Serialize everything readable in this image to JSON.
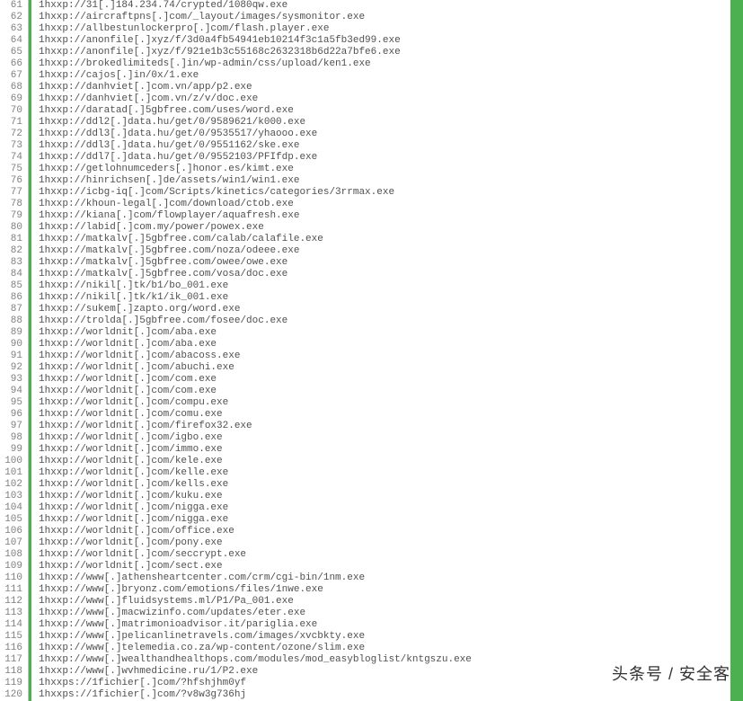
{
  "startLine": 61,
  "lines": [
    "1hxxp://31[.]184.234.74/crypted/1080qw.exe",
    "1hxxp://aircraftpns[.]com/_layout/images/sysmonitor.exe",
    "1hxxp://allbestunlockerpro[.]com/flash.player.exe",
    "1hxxp://anonfile[.]xyz/f/3d0a4fb54941eb10214f3c1a5fb3ed99.exe",
    "1hxxp://anonfile[.]xyz/f/921e1b3c55168c2632318b6d22a7bfe6.exe",
    "1hxxp://brokedlimiteds[.]in/wp-admin/css/upload/ken1.exe",
    "1hxxp://cajos[.]in/0x/1.exe",
    "1hxxp://danhviet[.]com.vn/app/p2.exe",
    "1hxxp://danhviet[.]com.vn/z/v/doc.exe",
    "1hxxp://daratad[.]5gbfree.com/uses/word.exe",
    "1hxxp://ddl2[.]data.hu/get/0/9589621/k000.exe",
    "1hxxp://ddl3[.]data.hu/get/0/9535517/yhaooo.exe",
    "1hxxp://ddl3[.]data.hu/get/0/9551162/ske.exe",
    "1hxxp://ddl7[.]data.hu/get/0/9552103/PFIfdp.exe",
    "1hxxp://getlohnumceders[.]honor.es/kimt.exe",
    "1hxxp://hinrichsen[.]de/assets/win1/win1.exe",
    "1hxxp://icbg-iq[.]com/Scripts/kinetics/categories/3rrmax.exe",
    "1hxxp://khoun-legal[.]com/download/ctob.exe",
    "1hxxp://kiana[.]com/flowplayer/aquafresh.exe",
    "1hxxp://labid[.]com.my/power/powex.exe",
    "1hxxp://matkalv[.]5gbfree.com/calab/calafile.exe",
    "1hxxp://matkalv[.]5gbfree.com/noza/odeee.exe",
    "1hxxp://matkalv[.]5gbfree.com/owee/owe.exe",
    "1hxxp://matkalv[.]5gbfree.com/vosa/doc.exe",
    "1hxxp://nikil[.]tk/b1/bo_001.exe",
    "1hxxp://nikil[.]tk/k1/ik_001.exe",
    "1hxxp://sukem[.]zapto.org/word.exe",
    "1hxxp://trolda[.]5gbfree.com/fosee/doc.exe",
    "1hxxp://worldnit[.]com/aba.exe",
    "1hxxp://worldnit[.]com/aba.exe",
    "1hxxp://worldnit[.]com/abacoss.exe",
    "1hxxp://worldnit[.]com/abuchi.exe",
    "1hxxp://worldnit[.]com/com.exe",
    "1hxxp://worldnit[.]com/com.exe",
    "1hxxp://worldnit[.]com/compu.exe",
    "1hxxp://worldnit[.]com/comu.exe",
    "1hxxp://worldnit[.]com/firefox32.exe",
    "1hxxp://worldnit[.]com/igbo.exe",
    "1hxxp://worldnit[.]com/immo.exe",
    "1hxxp://worldnit[.]com/kele.exe",
    "1hxxp://worldnit[.]com/kelle.exe",
    "1hxxp://worldnit[.]com/kells.exe",
    "1hxxp://worldnit[.]com/kuku.exe",
    "1hxxp://worldnit[.]com/nigga.exe",
    "1hxxp://worldnit[.]com/nigga.exe",
    "1hxxp://worldnit[.]com/office.exe",
    "1hxxp://worldnit[.]com/pony.exe",
    "1hxxp://worldnit[.]com/seccrypt.exe",
    "1hxxp://worldnit[.]com/sect.exe",
    "1hxxp://www[.]athensheartcenter.com/crm/cgi-bin/1nm.exe",
    "1hxxp://www[.]bryonz.com/emotions/files/1nwe.exe",
    "1hxxp://www[.]fluidsystems.ml/P1/Pa_001.exe",
    "1hxxp://www[.]macwizinfo.com/updates/eter.exe",
    "1hxxp://www[.]matrimonioadvisor.it/pariglia.exe",
    "1hxxp://www[.]pelicanlinetravels.com/images/xvcbkty.exe",
    "1hxxp://www[.]telemedia.co.za/wp-content/ozone/slim.exe",
    "1hxxp://www[.]wealthandhealthops.com/modules/mod_easybloglist/kntgszu.exe",
    "1hxxp://www[.]wvhmedicine.ru/1/P2.exe",
    "1hxxps://1fichier[.]com/?hfshjhm0yf",
    "1hxxps://1fichier[.]com/?v8w3g736hj"
  ],
  "watermark": "头条号 / 安全客"
}
